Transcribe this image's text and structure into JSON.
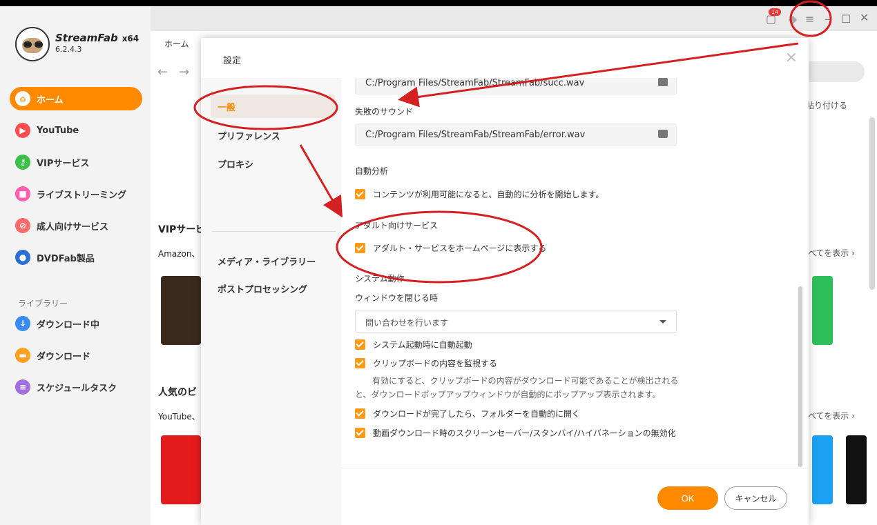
{
  "app": {
    "brand": "StreamFab",
    "arch": "x64",
    "version": "6.2.4.3",
    "notification_count": "14"
  },
  "sidebar": {
    "items": [
      {
        "label": "ホーム",
        "icon": "home-icon"
      },
      {
        "label": "YouTube",
        "icon": "youtube-icon"
      },
      {
        "label": "VIPサービス",
        "icon": "key-icon"
      },
      {
        "label": "ライブストリーミング",
        "icon": "camera-icon"
      },
      {
        "label": "成人向けサービス",
        "icon": "adult-icon"
      },
      {
        "label": "DVDFab製品",
        "icon": "dvdfab-icon"
      }
    ],
    "library_label": "ライブラリー",
    "library_items": [
      {
        "label": "ダウンロード中",
        "icon": "download-arrow-icon"
      },
      {
        "label": "ダウンロード",
        "icon": "folder-icon"
      },
      {
        "label": "スケジュールタスク",
        "icon": "schedule-icon"
      }
    ]
  },
  "main": {
    "tab_label": "ホーム",
    "paste_hint": "を貼り付ける",
    "vip_heading": "VIPサービ",
    "vip_sub": "Amazon、",
    "popular_heading": "人気のビ",
    "popular_sub": "YouTube、",
    "see_all_1": "べてを表示",
    "see_all_2": "べてを表示"
  },
  "dialog": {
    "title": "設定",
    "nav": [
      {
        "label": "一般"
      },
      {
        "label": "プリファレンス"
      },
      {
        "label": "プロキシ"
      },
      {
        "label": "メディア・ライブラリー"
      },
      {
        "label": "ポストプロセッシング"
      }
    ],
    "success_sound_path": "C:/Program Files/StreamFab/StreamFab/succ.wav",
    "fail_sound_label": "失敗のサウンド",
    "fail_sound_path": "C:/Program Files/StreamFab/StreamFab/error.wav",
    "auto_analysis_label": "自動分析",
    "auto_analysis_check": "コンテンツが利用可能になると、自動的に分析を開始します。",
    "adult_label": "アダルト向けサービス",
    "adult_check": "アダルト・サービスをホームページに表示する",
    "system_label": "システム動作",
    "close_window_label": "ウィンドウを閉じる時",
    "close_window_value": "問い合わせを行います",
    "startup_check": "システム起動時に自動起動",
    "clipboard_check": "クリップボードの内容を監視する",
    "clipboard_hint_1": "有効にすると、クリップボードの内容がダウンロード可能であることが検出される",
    "clipboard_hint_2": "と、ダウンロードポップアップウィンドウが自動的にポップアップ表示されます。",
    "open_folder_check": "ダウンロードが完了したら、フォルダーを自動的に開く",
    "screensaver_check": "動画ダウンロード時のスクリーンセーバー/スタンバイ/ハイバネーションの無効化",
    "ok_label": "OK",
    "cancel_label": "キャンセル"
  },
  "colors": {
    "accent": "#ff8a00",
    "annotation": "#d42020"
  }
}
